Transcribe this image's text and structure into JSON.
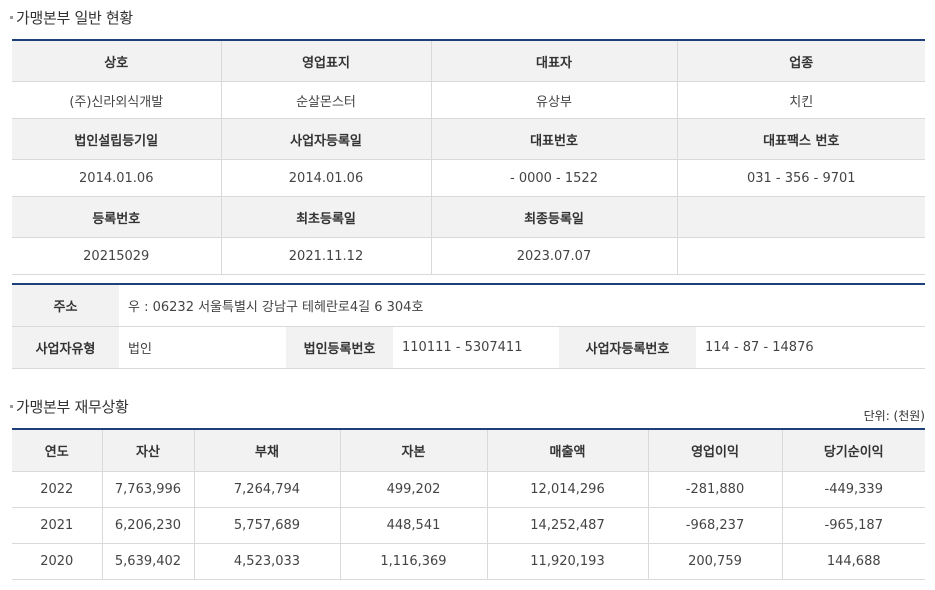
{
  "general": {
    "title": "가맹본부 일반 현황",
    "rows": [
      {
        "type": "header",
        "cells": [
          "상호",
          "영업표지",
          "대표자",
          "업종"
        ]
      },
      {
        "type": "value",
        "cells": [
          "(주)신라외식개발",
          "순살몬스터",
          "유상부",
          "치킨"
        ]
      },
      {
        "type": "header",
        "cells": [
          "법인설립등기일",
          "사업자등록일",
          "대표번호",
          "대표팩스 번호"
        ]
      },
      {
        "type": "value",
        "cells": [
          "2014.01.06",
          "2014.01.06",
          "-  0000  -  1522",
          "031  -  356  -  9701"
        ]
      },
      {
        "type": "header",
        "cells": [
          "등록번호",
          "최초등록일",
          "최종등록일",
          ""
        ]
      },
      {
        "type": "value",
        "cells": [
          "20215029",
          "2021.11.12",
          "2023.07.07",
          ""
        ]
      }
    ]
  },
  "address": {
    "label": "주소",
    "value": "우 : 06232 서울특별시 강남구 테헤란로4길 6 304호"
  },
  "business": {
    "type_label": "사업자유형",
    "type_value": "법인",
    "corp_no_label": "법인등록번호",
    "corp_no_value": "110111  -  5307411",
    "biz_no_label": "사업자등록번호",
    "biz_no_value": "114  -  87  -  14876"
  },
  "finance": {
    "title": "가맹본부 재무상황",
    "unit": "단위: (천원)",
    "headers": [
      "연도",
      "자산",
      "부채",
      "자본",
      "매출액",
      "영업이익",
      "당기순이익"
    ],
    "rows": [
      [
        "2022",
        "7,763,996",
        "7,264,794",
        "499,202",
        "12,014,296",
        "-281,880",
        "-449,339"
      ],
      [
        "2021",
        "6,206,230",
        "5,757,689",
        "448,541",
        "14,252,487",
        "-968,237",
        "-965,187"
      ],
      [
        "2020",
        "5,639,402",
        "4,523,033",
        "1,116,369",
        "11,920,193",
        "200,759",
        "144,688"
      ]
    ]
  }
}
